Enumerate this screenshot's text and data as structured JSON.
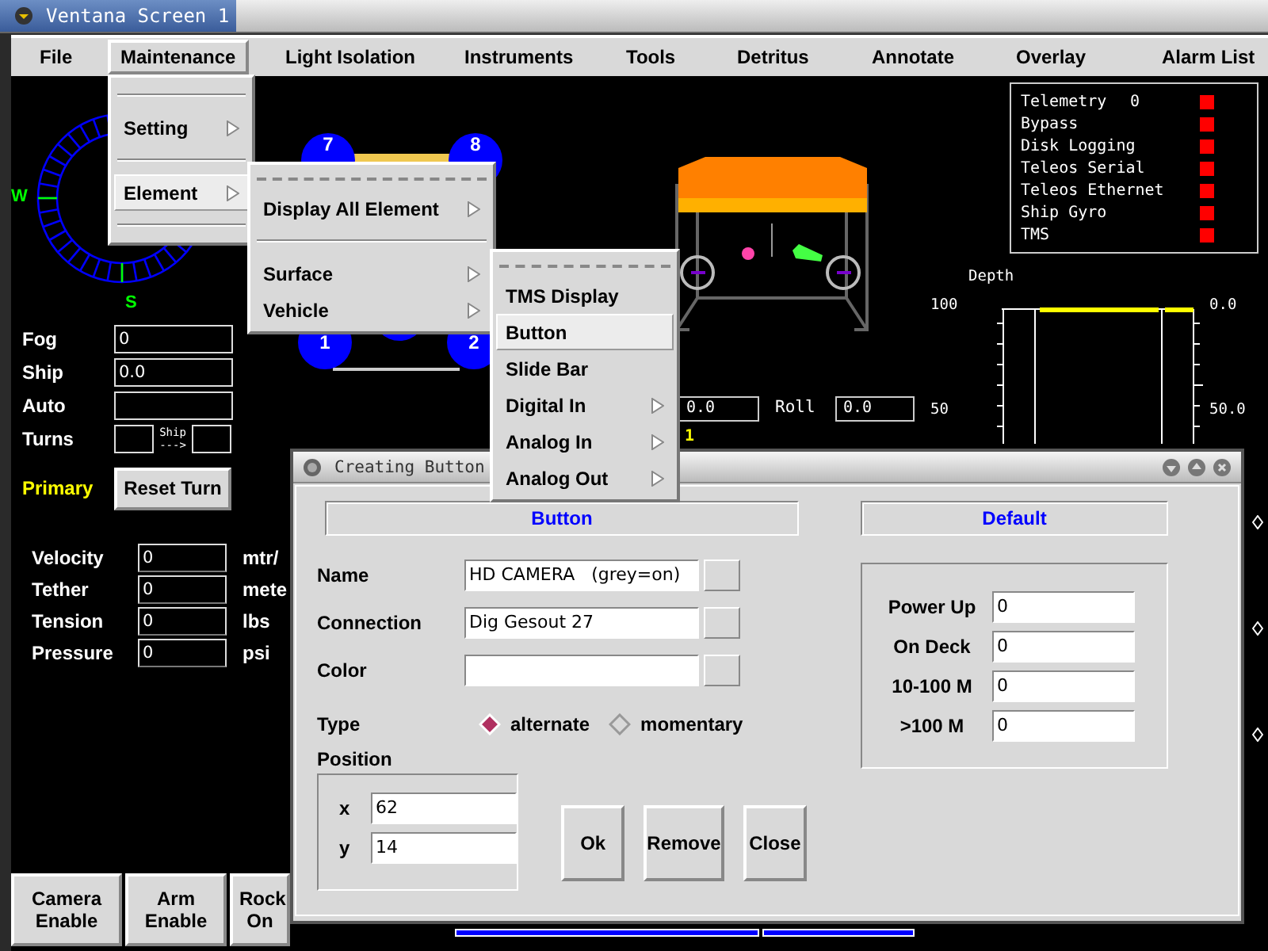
{
  "window": {
    "title": "Ventana Screen 1"
  },
  "menubar": [
    {
      "label": "File",
      "selected": false
    },
    {
      "label": "Maintenance",
      "selected": true
    },
    {
      "label": "Light Isolation",
      "selected": false
    },
    {
      "label": "Instruments",
      "selected": false
    },
    {
      "label": "Tools",
      "selected": false
    },
    {
      "label": "Detritus",
      "selected": false
    },
    {
      "label": "Annotate",
      "selected": false
    },
    {
      "label": "Overlay",
      "selected": false
    },
    {
      "label": "Alarm List",
      "selected": false
    }
  ],
  "maintenance_menu": [
    {
      "kind": "separator"
    },
    {
      "kind": "item",
      "label": "Setting",
      "selected": false,
      "submenu": true
    },
    {
      "kind": "separator"
    },
    {
      "kind": "item",
      "label": "Element",
      "selected": true,
      "submenu": true
    },
    {
      "kind": "separator"
    }
  ],
  "element_menu": [
    {
      "kind": "tearoff"
    },
    {
      "kind": "item",
      "label": "Display All Element",
      "selected": false,
      "submenu": true
    },
    {
      "kind": "separator"
    },
    {
      "kind": "item",
      "label": "Surface",
      "selected": false,
      "submenu": true
    },
    {
      "kind": "item",
      "label": "Vehicle",
      "selected": false,
      "submenu": true
    }
  ],
  "vehicle_menu": [
    {
      "kind": "tearoff"
    },
    {
      "kind": "item",
      "label": "TMS Display",
      "selected": false,
      "submenu": false
    },
    {
      "kind": "item",
      "label": "Button",
      "selected": true,
      "submenu": false
    },
    {
      "kind": "item",
      "label": "Slide Bar",
      "selected": false,
      "submenu": false
    },
    {
      "kind": "item",
      "label": "Digital In",
      "selected": false,
      "submenu": true
    },
    {
      "kind": "item",
      "label": "Analog In",
      "selected": false,
      "submenu": true
    },
    {
      "kind": "item",
      "label": "Analog Out",
      "selected": false,
      "submenu": true
    }
  ],
  "compass": {
    "west": "W",
    "south": "S"
  },
  "readouts": [
    {
      "label": "Fog",
      "value": "0"
    },
    {
      "label": "Ship",
      "value": "0.0"
    },
    {
      "label": "Auto"
    }
  ],
  "turns": {
    "label": "Turns",
    "ship_label": "Ship",
    "arrow": "--->"
  },
  "primary": "Primary",
  "reset_button": "Reset Turn",
  "sensors": [
    {
      "label": "Velocity",
      "value": "0",
      "unit": "mtr/"
    },
    {
      "label": "Tether",
      "value": "0",
      "unit": "mete"
    },
    {
      "label": "Tension",
      "value": "0",
      "unit": "lbs"
    },
    {
      "label": "Pressure",
      "value": "0",
      "unit": "psi"
    }
  ],
  "bottom_buttons": [
    "Camera Enable",
    "Arm Enable",
    "Rock On"
  ],
  "thrusters": [
    "7",
    "8",
    "1",
    "2"
  ],
  "attitude": {
    "pitch_value": "0.0",
    "roll_label": "Roll",
    "roll_value": "0.0",
    "marker": "1"
  },
  "alarms": [
    {
      "label": "Telemetry",
      "value": "0",
      "color": "#ff0000"
    },
    {
      "label": "Bypass",
      "color": "#ff0000"
    },
    {
      "label": "Disk Logging",
      "color": "#ff0000"
    },
    {
      "label": "Teleos Serial",
      "color": "#ff0000"
    },
    {
      "label": "Teleos Ethernet",
      "color": "#ff0000"
    },
    {
      "label": "Ship Gyro",
      "color": "#ff0000"
    },
    {
      "label": "TMS",
      "color": "#ff0000"
    }
  ],
  "depth_gauge": {
    "title": "Depth",
    "left_ticks": [
      "100",
      "50"
    ],
    "right_ticks": [
      "0.0",
      "50.0"
    ]
  },
  "dialog": {
    "title": "Creating Button",
    "heading": "Button",
    "default_heading": "Default",
    "fields": [
      {
        "label": "Name",
        "value": "HD CAMERA   (grey=on)"
      },
      {
        "label": "Connection",
        "value": "Dig Gesout 27"
      },
      {
        "label": "Color"
      }
    ],
    "type_label": "Type",
    "type_options": [
      {
        "label": "alternate",
        "selected": true
      },
      {
        "label": "momentary",
        "selected": false
      }
    ],
    "position_label": "Position",
    "position": [
      {
        "label": "x",
        "value": "62"
      },
      {
        "label": "y",
        "value": "14"
      }
    ],
    "buttons": [
      "Ok",
      "Remove",
      "Close"
    ],
    "defaults": [
      {
        "label": "Power Up",
        "value": "0"
      },
      {
        "label": "On Deck",
        "value": "0"
      },
      {
        "label": "10-100 M",
        "value": "0"
      },
      {
        "label": ">100 M",
        "value": "0"
      }
    ]
  }
}
